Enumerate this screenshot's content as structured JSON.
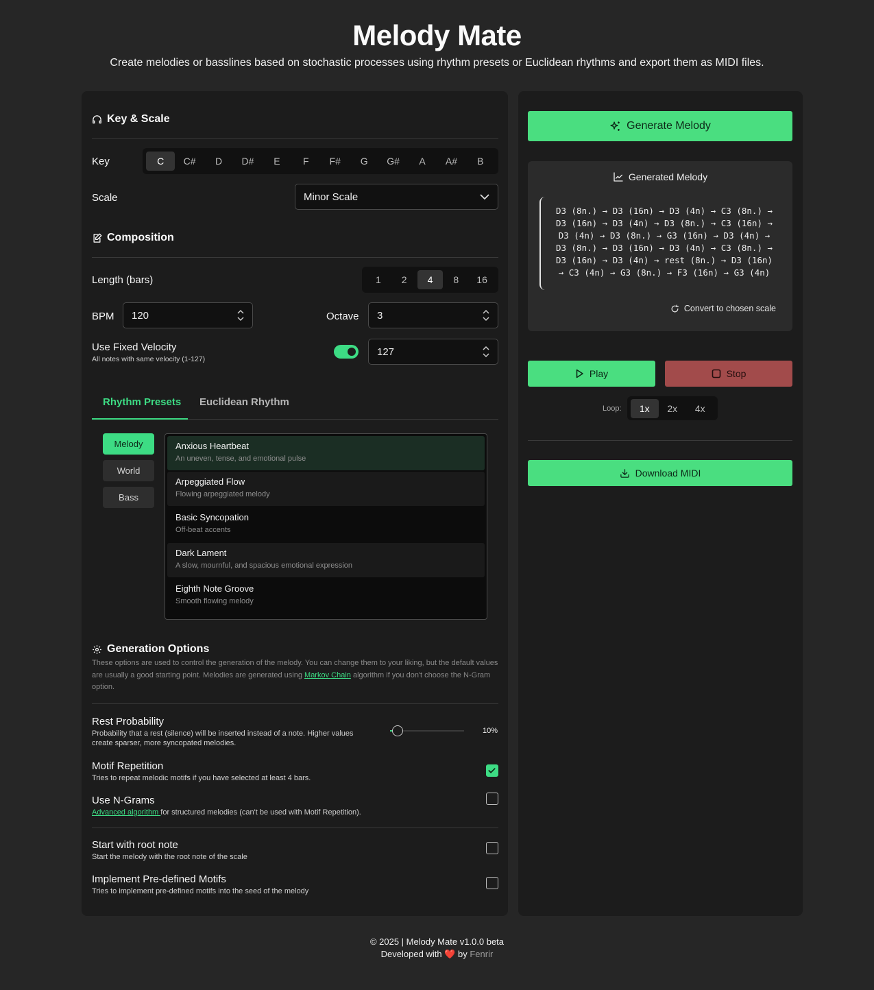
{
  "header": {
    "title": "Melody Mate",
    "subtitle": "Create melodies or basslines based on stochastic processes using rhythm presets or Euclidean rhythms and export them as MIDI files."
  },
  "key_scale": {
    "section_title": "Key & Scale",
    "key_label": "Key",
    "keys": [
      "C",
      "C#",
      "D",
      "D#",
      "E",
      "F",
      "F#",
      "G",
      "G#",
      "A",
      "A#",
      "B"
    ],
    "selected_key": "C",
    "scale_label": "Scale",
    "scale_value": "Minor Scale"
  },
  "composition": {
    "section_title": "Composition",
    "length_label": "Length (bars)",
    "lengths": [
      "1",
      "2",
      "4",
      "8",
      "16"
    ],
    "selected_length": "4",
    "bpm_label": "BPM",
    "bpm_value": "120",
    "octave_label": "Octave",
    "octave_value": "3",
    "velocity_label": "Use Fixed Velocity",
    "velocity_desc": "All notes with same velocity (1-127)",
    "velocity_enabled": true,
    "velocity_value": "127"
  },
  "rhythm": {
    "tabs": [
      "Rhythm Presets",
      "Euclidean Rhythm"
    ],
    "active_tab": "Rhythm Presets",
    "categories": [
      "Melody",
      "World",
      "Bass"
    ],
    "active_category": "Melody",
    "presets": [
      {
        "name": "Anxious Heartbeat",
        "desc": "An uneven, tense, and emotional pulse"
      },
      {
        "name": "Arpeggiated Flow",
        "desc": "Flowing arpeggiated melody"
      },
      {
        "name": "Basic Syncopation",
        "desc": "Off-beat accents"
      },
      {
        "name": "Dark Lament",
        "desc": "A slow, mournful, and spacious emotional expression"
      },
      {
        "name": "Eighth Note Groove",
        "desc": "Smooth flowing melody"
      }
    ],
    "selected_preset": "Anxious Heartbeat"
  },
  "generation": {
    "section_title": "Generation Options",
    "desc_before": "These options are used to control the generation of the melody. You can change them to your liking, but the default values are usually a good starting point. Melodies are generated using ",
    "desc_link": "Markov Chain",
    "desc_after": " algorithm if you don't choose the N-Gram option.",
    "rest_title": "Rest Probability",
    "rest_desc": "Probability that a rest (silence) will be inserted instead of a note. Higher values create sparser, more syncopated melodies.",
    "rest_value": "10%",
    "rest_fraction": 0.1,
    "motif_title": "Motif Repetition",
    "motif_desc": "Tries to repeat melodic motifs if you have selected at least 4 bars.",
    "motif_checked": true,
    "ngram_title": "Use N-Grams",
    "ngram_link": "Advanced algorithm ",
    "ngram_desc": "for structured melodies (can't be used with Motif Repetition).",
    "ngram_checked": false,
    "root_title": "Start with root note",
    "root_desc": "Start the melody with the root note of the scale",
    "root_checked": false,
    "predef_title": "Implement Pre-defined Motifs",
    "predef_desc": "Tries to implement pre-defined motifs into the seed of the melody",
    "predef_checked": false
  },
  "right": {
    "generate_label": "Generate Melody",
    "melody_title": "Generated Melody",
    "melody_text": "D3 (8n.) → D3 (16n) → D3 (4n) → C3 (8n.) → D3 (16n) → D3 (4n) → D3 (8n.) → C3 (16n) → D3 (4n) → D3 (8n.) → G3 (16n) → D3 (4n) → D3 (8n.) → D3 (16n) → D3 (4n) → C3 (8n.) → D3 (16n) → D3 (4n) → rest (8n.) → D3 (16n) → C3 (4n) → G3 (8n.) → F3 (16n) → G3 (4n)",
    "convert_label": "Convert to chosen scale",
    "play_label": "Play",
    "stop_label": "Stop",
    "loop_label": "Loop:",
    "loops": [
      "1x",
      "2x",
      "4x"
    ],
    "selected_loop": "1x",
    "download_label": "Download MIDI"
  },
  "footer": {
    "line1": "© 2025 | Melody Mate v1.0.0 beta",
    "line2_before": "Developed with",
    "heart": "❤️",
    "line2_by": "by",
    "author": "Fenrir"
  },
  "colors": {
    "accent": "#4ade80",
    "stop": "#a24b4b",
    "background": "#262626",
    "panel": "#1c1c1c"
  }
}
